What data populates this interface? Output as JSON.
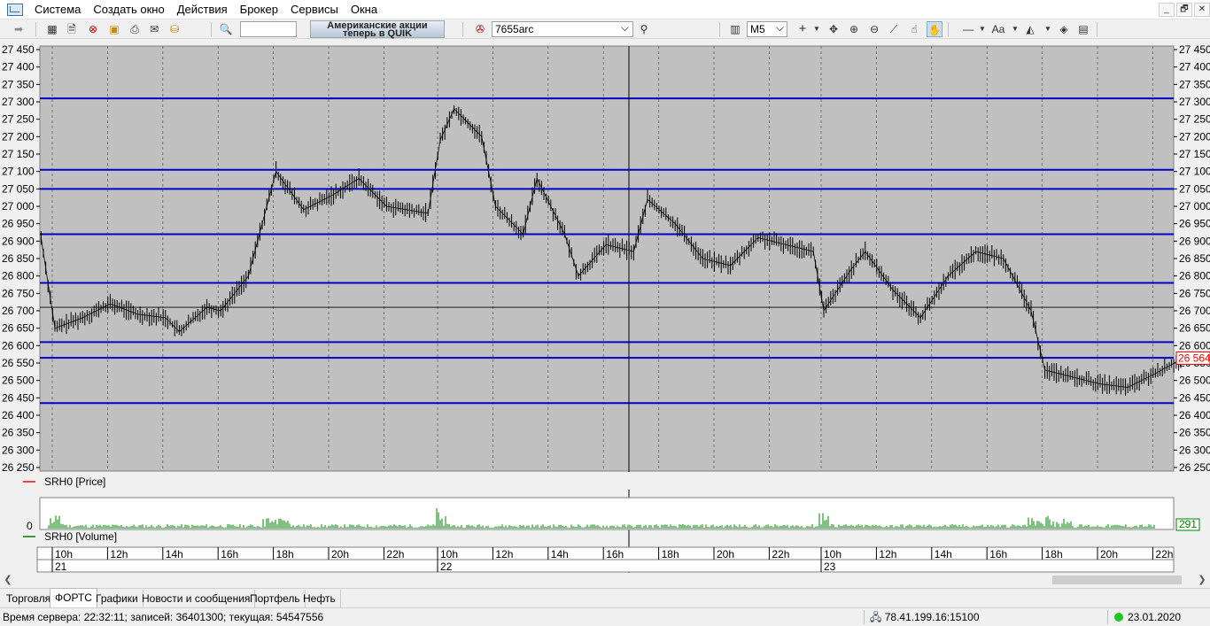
{
  "menu": {
    "items": [
      "Система",
      "Создать окно",
      "Действия",
      "Брокер",
      "Сервисы",
      "Окна"
    ],
    "window_controls": [
      "_",
      "🗗",
      "✕"
    ]
  },
  "toolbar": {
    "ad_banner_line1": "Американские акции",
    "ad_banner_line2": "теперь в QUIK",
    "ticker": "7655arc",
    "timeframe": "M5",
    "icons": [
      "arrow-icon",
      "table-icon",
      "order-icon",
      "cancel-order-icon",
      "lock-icon",
      "print-icon",
      "mail-icon",
      "db-icon",
      "search-icon",
      "ticker-icon",
      "find-icon",
      "chart-bars-icon",
      "crosshair-icon",
      "move-icon",
      "zoom-in-icon",
      "zoom-out-icon",
      "ruler-icon",
      "hand-icon",
      "pan-icon",
      "line-icon",
      "text-icon",
      "fill-icon",
      "eye-icon",
      "layers-icon"
    ]
  },
  "chart": {
    "price_legend": "SRH0 [Price]",
    "volume_legend": "SRH0 [Volume]",
    "current_price_label": "26 564",
    "volume_value_label": "291",
    "volume_zero_label": "0",
    "price_line_color": "#000000",
    "horizontal_line_color": "#0000cc",
    "current_price_color": "#ff0000",
    "volume_color": "#008000",
    "background_color": "#c0c0c0"
  },
  "chart_data": {
    "type": "line",
    "instrument": "SRH0",
    "interval": "M5",
    "y_ticks": [
      "27 450",
      "27 400",
      "27 350",
      "27 300",
      "27 250",
      "27 200",
      "27 150",
      "27 100",
      "27 050",
      "27 000",
      "26 950",
      "26 900",
      "26 850",
      "26 800",
      "26 750",
      "26 700",
      "26 650",
      "26 600",
      "26 550",
      "26 500",
      "26 450",
      "26 400",
      "26 350",
      "26 300",
      "26 250"
    ],
    "ylim": [
      26250,
      27450
    ],
    "x_time_labels": [
      "10h",
      "12h",
      "14h",
      "16h",
      "18h",
      "20h",
      "22h",
      "10h",
      "12h",
      "14h",
      "16h",
      "18h",
      "20h",
      "22h",
      "10h",
      "12h",
      "14h",
      "16h",
      "18h",
      "20h",
      "22h"
    ],
    "x_day_labels": [
      "21",
      "22",
      "23"
    ],
    "horizontal_levels": [
      27310,
      27105,
      27050,
      26920,
      26780,
      26610,
      26565,
      26435
    ],
    "crosshair_price": 26710,
    "current_price": 26564,
    "price_series": {
      "name": "SRH0 [Price]",
      "x": [
        "21 09:30",
        "21 10:00",
        "21 11:00",
        "21 12:00",
        "21 13:00",
        "21 14:00",
        "21 14:30",
        "21 15:30",
        "21 16:00",
        "21 17:00",
        "21 17:30",
        "21 18:00",
        "21 19:00",
        "21 20:00",
        "21 21:00",
        "21 22:00",
        "21 23:30",
        "22 10:00",
        "22 10:30",
        "22 11:30",
        "22 12:00",
        "22 13:00",
        "22 13:30",
        "22 14:30",
        "22 15:00",
        "22 16:00",
        "22 17:00",
        "22 17:30",
        "22 18:30",
        "22 19:30",
        "22 20:30",
        "22 21:30",
        "22 23:30",
        "23 10:00",
        "23 11:00",
        "23 11:30",
        "23 12:30",
        "23 13:30",
        "23 14:30",
        "23 15:30",
        "23 16:30",
        "23 17:30",
        "23 18:00",
        "23 18:30",
        "23 20:00",
        "23 21:00",
        "23 22:00",
        "23 23:00"
      ],
      "values": [
        26910,
        26650,
        26680,
        26720,
        26690,
        26680,
        26640,
        26710,
        26700,
        26800,
        26950,
        27100,
        26990,
        27030,
        27080,
        27000,
        26980,
        27190,
        27280,
        27200,
        27000,
        26920,
        27080,
        26920,
        26800,
        26890,
        26870,
        27020,
        26950,
        26850,
        26830,
        26910,
        26870,
        26700,
        26820,
        26870,
        26760,
        26680,
        26800,
        26870,
        26850,
        26700,
        26530,
        26520,
        26490,
        26480,
        26520,
        26564
      ]
    },
    "volume_series": {
      "name": "SRH0 [Volume]",
      "peak_label": "291"
    }
  },
  "tabs": [
    "Торговля",
    "ФОРТС",
    "Графики",
    "Новости и сообщения",
    "Портфель",
    "Нефть"
  ],
  "active_tab": "ФОРТС",
  "status": {
    "server": "Время сервера: 22:32:11; записей: 36401300; текущая: 54547556",
    "connection": "78.41.199.16:15100",
    "date": "23.01.2020"
  }
}
